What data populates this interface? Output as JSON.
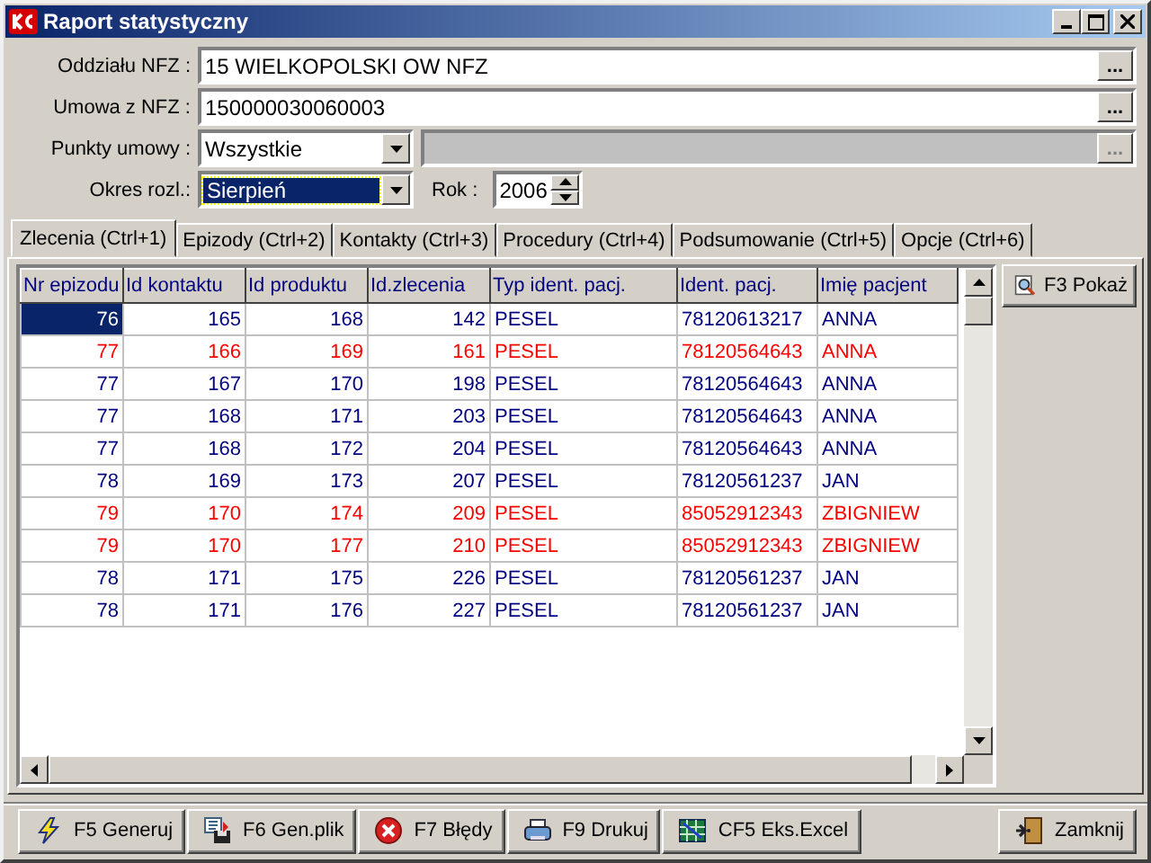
{
  "window": {
    "title": "Raport statystyczny"
  },
  "form": {
    "branch": {
      "label": "Oddziału NFZ :",
      "value": "15 WIELKOPOLSKI OW NFZ",
      "button": "..."
    },
    "contract": {
      "label": "Umowa z NFZ :",
      "value": "150000030060003",
      "button": "..."
    },
    "points": {
      "label": "Punkty umowy :",
      "value": "Wszystkie",
      "extra_button": "...",
      "extra_disabled": true
    },
    "period": {
      "label": "Okres rozl.:",
      "value": "Sierpień",
      "focused": true
    },
    "year": {
      "label": "Rok :",
      "value": "2006"
    }
  },
  "tabs": [
    {
      "label": "Zlecenia (Ctrl+1)",
      "selected": true
    },
    {
      "label": "Epizody (Ctrl+2)",
      "selected": false
    },
    {
      "label": "Kontakty (Ctrl+3)",
      "selected": false
    },
    {
      "label": "Procedury (Ctrl+4)",
      "selected": false
    },
    {
      "label": "Podsumowanie (Ctrl+5)",
      "selected": false
    },
    {
      "label": "Opcje (Ctrl+6)",
      "selected": false
    }
  ],
  "table": {
    "columns": [
      "Nr epizodu",
      "Id kontaktu",
      "Id produktu",
      "Id.zlecenia",
      "Typ ident. pacj.",
      "Ident. pacj.",
      "Imię pacjent"
    ],
    "rows": [
      {
        "selected": true,
        "color": "#000080",
        "cells": [
          "76",
          "165",
          "168",
          "142",
          "PESEL",
          "78120613217",
          "ANNA"
        ]
      },
      {
        "selected": false,
        "color": "#ff0000",
        "cells": [
          "77",
          "166",
          "169",
          "161",
          "PESEL",
          "78120564643",
          "ANNA"
        ]
      },
      {
        "selected": false,
        "color": "#000080",
        "cells": [
          "77",
          "167",
          "170",
          "198",
          "PESEL",
          "78120564643",
          "ANNA"
        ]
      },
      {
        "selected": false,
        "color": "#000080",
        "cells": [
          "77",
          "168",
          "171",
          "203",
          "PESEL",
          "78120564643",
          "ANNA"
        ]
      },
      {
        "selected": false,
        "color": "#000080",
        "cells": [
          "77",
          "168",
          "172",
          "204",
          "PESEL",
          "78120564643",
          "ANNA"
        ]
      },
      {
        "selected": false,
        "color": "#000080",
        "cells": [
          "78",
          "169",
          "173",
          "207",
          "PESEL",
          "78120561237",
          "JAN"
        ]
      },
      {
        "selected": false,
        "color": "#ff0000",
        "cells": [
          "79",
          "170",
          "174",
          "209",
          "PESEL",
          "85052912343",
          "ZBIGNIEW"
        ]
      },
      {
        "selected": false,
        "color": "#ff0000",
        "cells": [
          "79",
          "170",
          "177",
          "210",
          "PESEL",
          "85052912343",
          "ZBIGNIEW"
        ]
      },
      {
        "selected": false,
        "color": "#000080",
        "cells": [
          "78",
          "171",
          "175",
          "226",
          "PESEL",
          "78120561237",
          "JAN"
        ]
      },
      {
        "selected": false,
        "color": "#000080",
        "cells": [
          "78",
          "171",
          "176",
          "227",
          "PESEL",
          "78120561237",
          "JAN"
        ]
      }
    ]
  },
  "side_button": "F3 Pokaż",
  "toolbar": [
    "F5 Generuj",
    "F6 Gen.plik",
    "F7 Błędy",
    "F9 Drukuj",
    "CF5 Eks.Excel"
  ],
  "close_button": "Zamknij"
}
